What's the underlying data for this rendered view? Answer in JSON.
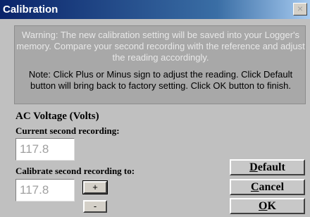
{
  "window": {
    "title": "Calibration",
    "close_glyph": "×"
  },
  "notice": {
    "warning": "Warning: The new calibration setting will be saved into your Logger's memory. Compare your second recording with the reference and adjust the reading accordingly.",
    "note": "Note: Click Plus or Minus sign to adjust the reading. Click Default button will bring back to factory setting. Click OK button to finish."
  },
  "measurement": {
    "section_title": "AC Voltage (Volts)",
    "current_label": "Current second recording:",
    "current_value": "117.8",
    "calibrate_label": "Calibrate second recording to:",
    "calibrate_value": "117.8"
  },
  "adjust": {
    "plus_label": "+",
    "minus_label": "-"
  },
  "buttons": {
    "default": {
      "mnemonic": "D",
      "rest": "efault"
    },
    "cancel": {
      "mnemonic": "C",
      "rest": "ancel"
    },
    "ok": {
      "mnemonic": "O",
      "rest": "K"
    }
  },
  "icons": {
    "close": "close-icon"
  }
}
